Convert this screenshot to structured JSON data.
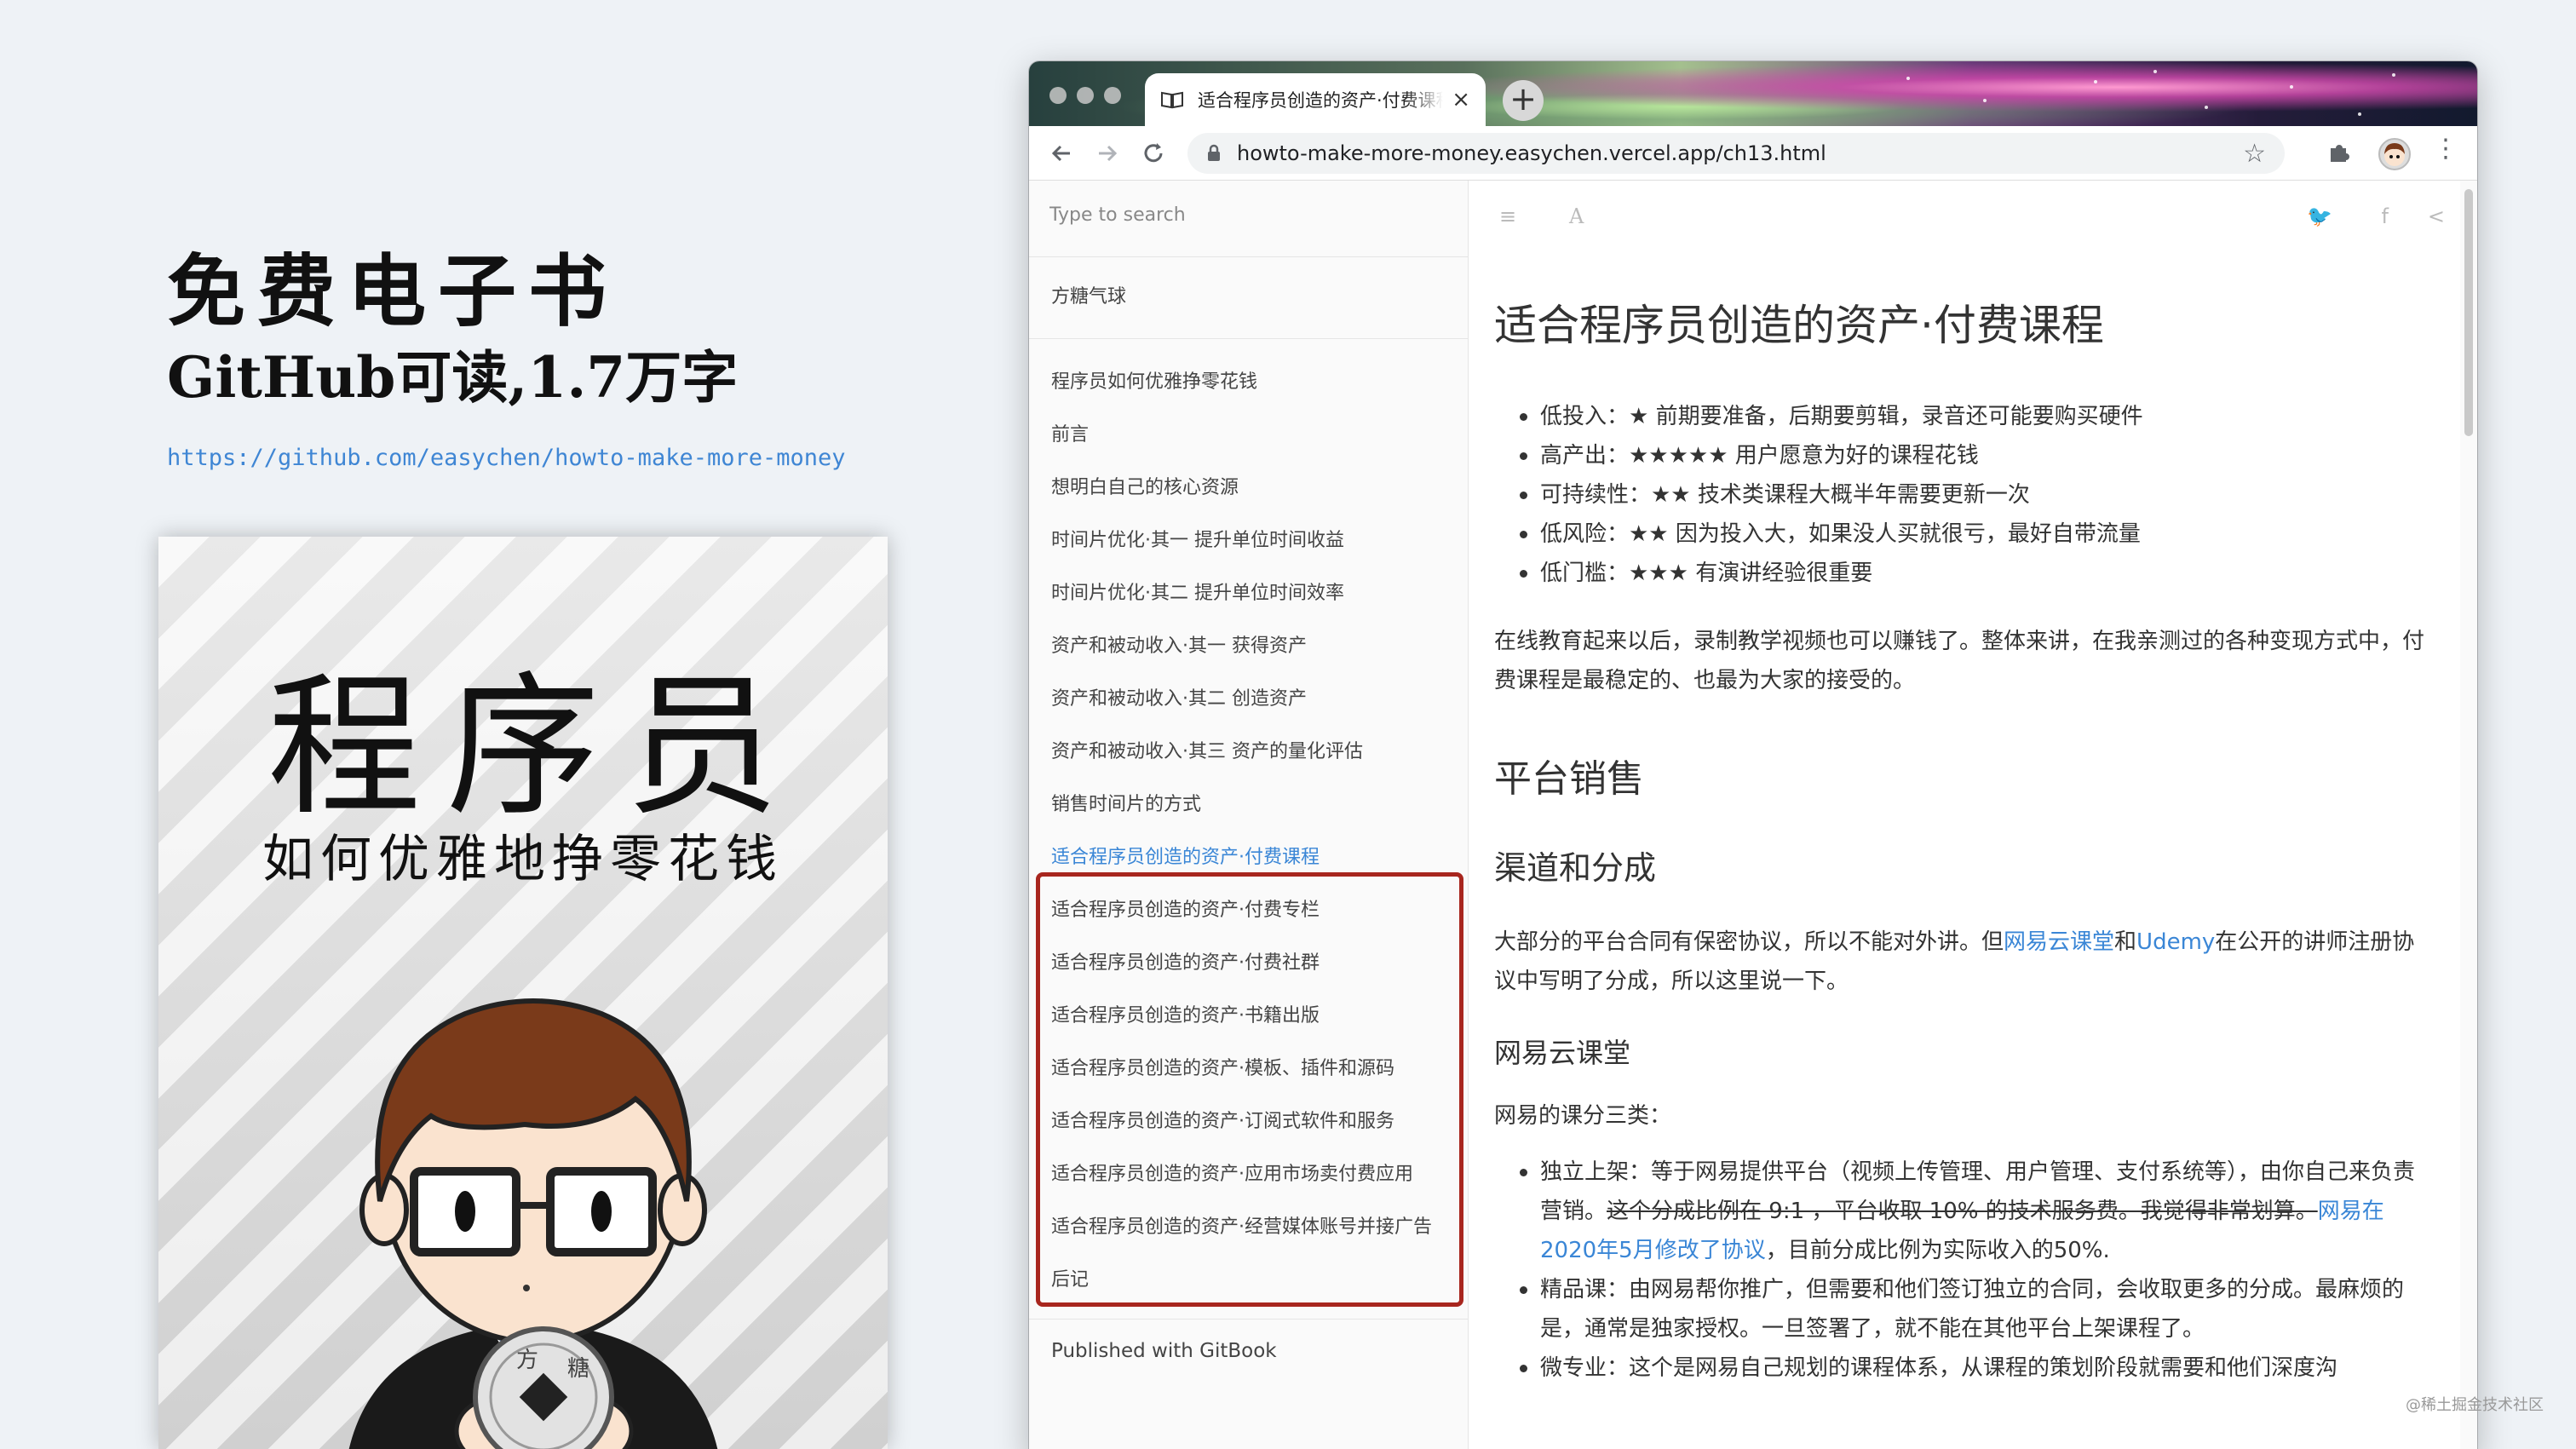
{
  "promo": {
    "title": "免费电子书",
    "subtitle": "GitHub可读,1.7万字",
    "link": "https://github.com/easychen/howto-make-more-money"
  },
  "book": {
    "title": "程序员",
    "subtitle": "如何优雅地挣零花钱",
    "coin_char_top": "方",
    "coin_char_right": "糖"
  },
  "browser": {
    "tab_title": "适合程序员创造的资产·付费课程",
    "tab_close": "×",
    "new_tab": "+",
    "url": "howto-make-more-money.easychen.vercel.app/ch13.html",
    "bookmark": "☆",
    "menu": "⋮"
  },
  "sidebar": {
    "search_placeholder": "Type to search",
    "top_item": "方糖气球",
    "items": [
      "程序员如何优雅挣零花钱",
      "前言",
      "想明白自己的核心资源",
      "时间片优化·其一 提升单位时间收益",
      "时间片优化·其二 提升单位时间效率",
      "资产和被动收入·其一 获得资产",
      "资产和被动收入·其二 创造资产",
      "资产和被动收入·其三 资产的量化评估",
      "销售时间片的方式"
    ],
    "highlighted_items": [
      "适合程序员创造的资产·付费课程",
      "适合程序员创造的资产·付费专栏",
      "适合程序员创造的资产·付费社群",
      "适合程序员创造的资产·书籍出版",
      "适合程序员创造的资产·模板、插件和源码",
      "适合程序员创造的资产·订阅式软件和服务",
      "适合程序员创造的资产·应用市场卖付费应用",
      "适合程序员创造的资产·经营媒体账号并接广告"
    ],
    "last_item": "后记",
    "published": "Published with GitBook"
  },
  "header_icons": {
    "toc": "≡",
    "font": "A",
    "twitter": "🐦",
    "facebook": "f",
    "share": "<"
  },
  "article": {
    "title": "适合程序员创造的资产·付费课程",
    "bullets": [
      "低投入：★ 前期要准备，后期要剪辑，录音还可能要购买硬件",
      "高产出：★★★★★ 用户愿意为好的课程花钱",
      "可持续性：★★ 技术类课程大概半年需要更新一次",
      "低风险：★★ 因为投入大，如果没人买就很亏，最好自带流量",
      "低门槛：★★★ 有演讲经验很重要"
    ],
    "intro": "在线教育起来以后，录制教学视频也可以赚钱了。整体来讲，在我亲测过的各种变现方式中，付费课程是最稳定的、也最为大家的接受的。",
    "h2": "平台销售",
    "h3": "渠道和分成",
    "p2_a": "大部分的平台合同有保密协议，所以不能对外讲。但",
    "p2_link1": "网易云课堂",
    "p2_b": "和",
    "p2_link2": "Udemy",
    "p2_c": "在公开的讲师注册协议中写明了分成，所以这里说一下。",
    "h4": "网易云课堂",
    "p3": "网易的课分三类：",
    "list2": {
      "item1_a": "独立上架：等于网易提供平台（视频上传管理、用户管理、支付系统等），由你自己来负责营销。",
      "item1_strike": "这个分成比例在 9:1 ，平台收取 10% 的技术服务费。我觉得非常划算。",
      "item1_link": "网易在2020年5月修改了协议",
      "item1_b": "，目前分成比例为实际收入的50%.",
      "item2": "精品课：由网易帮你推广，但需要和他们签订独立的合同，会收取更多的分成。最麻烦的是，通常是独家授权。一旦签署了，就不能在其他平台上架课程了。",
      "item3": "微专业：这个是网易自己规划的课程体系，从课程的策划阶段就需要和他们深度沟"
    }
  },
  "watermark": "@稀土掘金技术社区",
  "colors": {
    "accent_link": "#3a86d6",
    "highlight_border": "#a8261e",
    "background": "#eef2f6"
  }
}
